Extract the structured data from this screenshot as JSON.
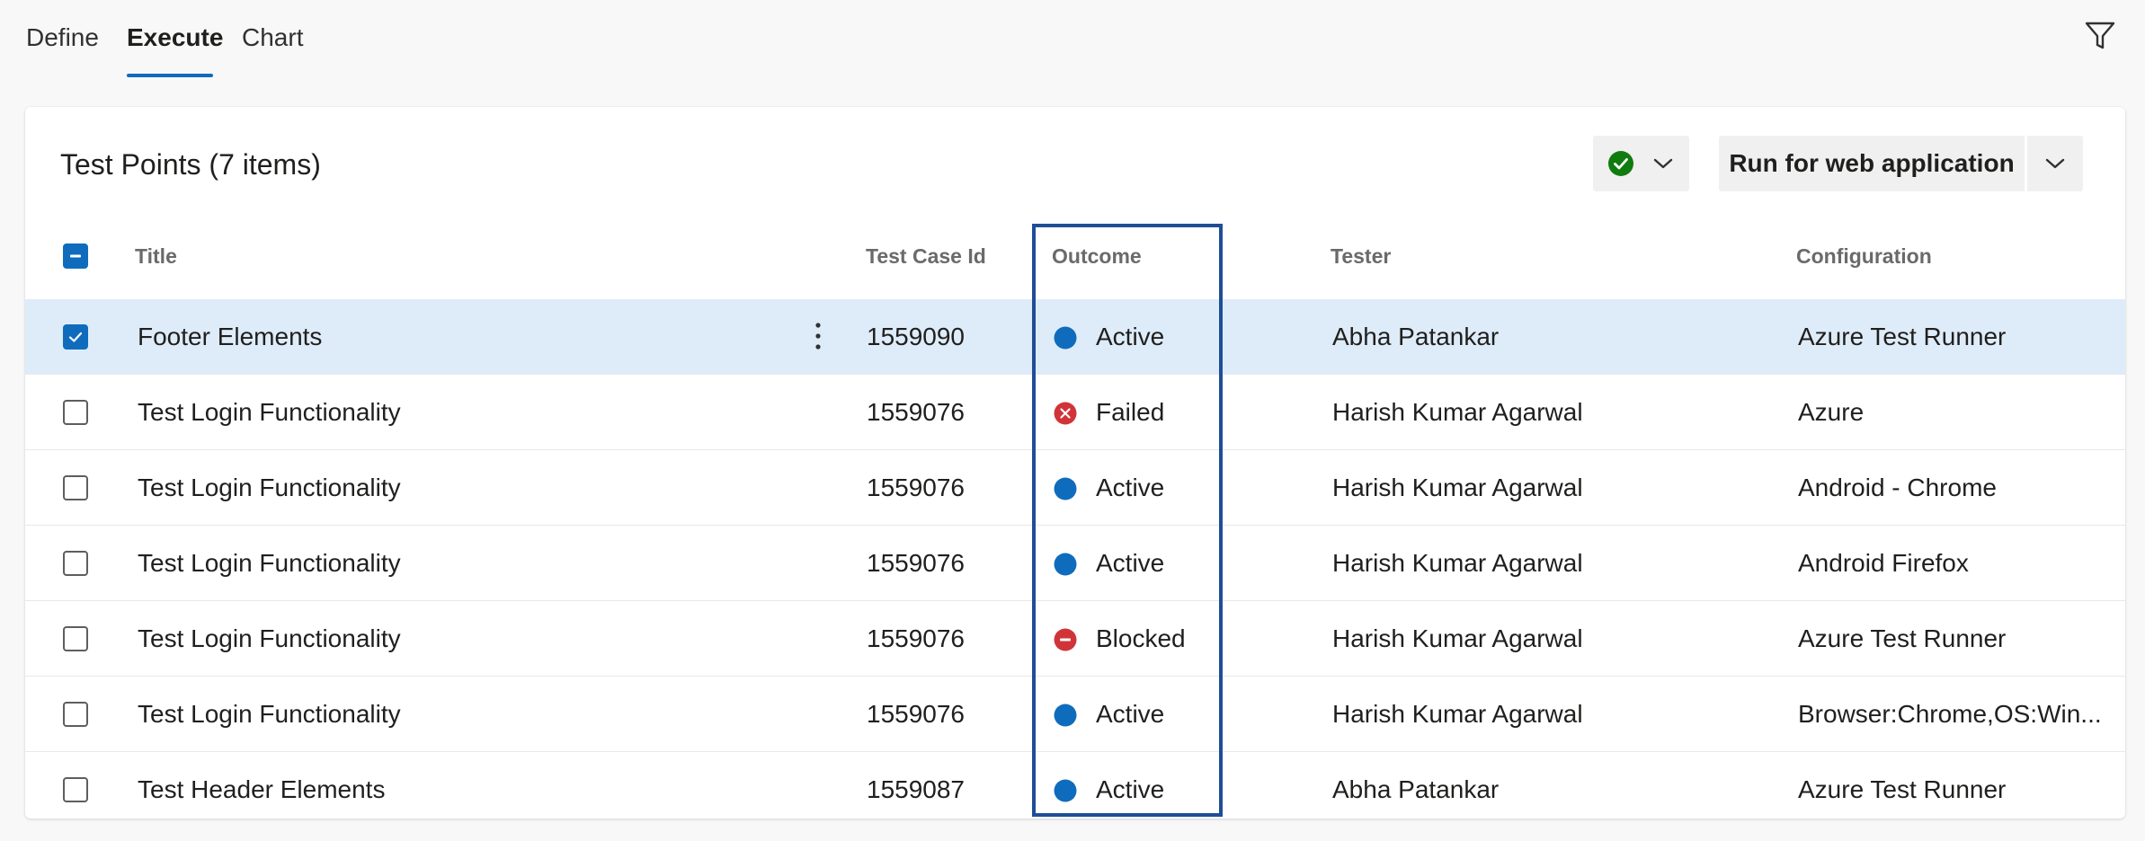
{
  "tabs": [
    {
      "label": "Define",
      "active": false
    },
    {
      "label": "Execute",
      "active": true
    },
    {
      "label": "Chart",
      "active": false
    }
  ],
  "toolbar": {
    "filter_icon": "filter-icon"
  },
  "card": {
    "title": "Test Points (7 items)",
    "status_dropdown_icon": "check-circle-icon",
    "run_button_label": "Run for web application"
  },
  "table": {
    "columns": {
      "title": "Title",
      "test_case_id": "Test Case Id",
      "outcome": "Outcome",
      "tester": "Tester",
      "configuration": "Configuration"
    },
    "rows": [
      {
        "selected": true,
        "title": "Footer Elements",
        "test_case_id": "1559090",
        "outcome": "Active",
        "outcome_icon": "active-dot-icon",
        "tester": "Abha Patankar",
        "configuration": "Azure Test Runner"
      },
      {
        "selected": false,
        "title": "Test Login Functionality",
        "test_case_id": "1559076",
        "outcome": "Failed",
        "outcome_icon": "failed-x-icon",
        "tester": "Harish Kumar Agarwal",
        "configuration": "Azure"
      },
      {
        "selected": false,
        "title": "Test Login Functionality",
        "test_case_id": "1559076",
        "outcome": "Active",
        "outcome_icon": "active-dot-icon",
        "tester": "Harish Kumar Agarwal",
        "configuration": "Android - Chrome"
      },
      {
        "selected": false,
        "title": "Test Login Functionality",
        "test_case_id": "1559076",
        "outcome": "Active",
        "outcome_icon": "active-dot-icon",
        "tester": "Harish Kumar Agarwal",
        "configuration": "Android Firefox"
      },
      {
        "selected": false,
        "title": "Test Login Functionality",
        "test_case_id": "1559076",
        "outcome": "Blocked",
        "outcome_icon": "blocked-minus-icon",
        "tester": "Harish Kumar Agarwal",
        "configuration": "Azure Test Runner"
      },
      {
        "selected": false,
        "title": "Test Login Functionality",
        "test_case_id": "1559076",
        "outcome": "Active",
        "outcome_icon": "active-dot-icon",
        "tester": "Harish Kumar Agarwal",
        "configuration": "Browser:Chrome,OS:Win..."
      },
      {
        "selected": false,
        "title": "Test Header Elements",
        "test_case_id": "1559087",
        "outcome": "Active",
        "outcome_icon": "active-dot-icon",
        "tester": "Abha Patankar",
        "configuration": "Azure Test Runner"
      }
    ]
  },
  "colors": {
    "accent": "#0f6cbd",
    "active": "#0f6cbd",
    "failed": "#d13438",
    "blocked": "#d13438",
    "passed": "#107c10",
    "selected_row": "#deecf9",
    "highlight_box": "#1f4e96"
  }
}
